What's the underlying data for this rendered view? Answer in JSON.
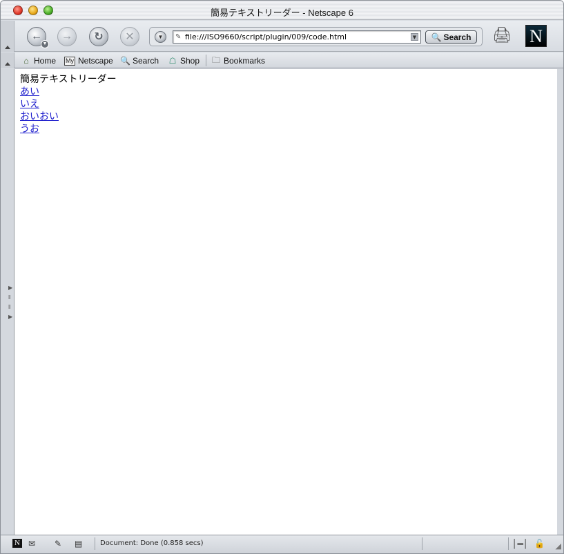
{
  "window": {
    "title": "簡易テキストリーダー - Netscape 6"
  },
  "navigation": {
    "back_icon": "back-arrow-icon",
    "forward_icon": "forward-arrow-icon",
    "reload_icon": "reload-icon",
    "stop_icon": "stop-icon",
    "url": "file:///ISO9660/script/plugin/009/code.html",
    "search_label": "Search"
  },
  "personal_toolbar": {
    "items": [
      {
        "label": "Home",
        "icon": "home-icon"
      },
      {
        "label": "Netscape",
        "icon": "my-netscape-icon"
      },
      {
        "label": "Search",
        "icon": "search-icon"
      },
      {
        "label": "Shop",
        "icon": "shop-icon"
      },
      {
        "label": "Bookmarks",
        "icon": "folder-icon"
      }
    ]
  },
  "page": {
    "heading": "簡易テキストリーダー",
    "links": [
      "あい",
      "いえ",
      "おいおい",
      "うお"
    ]
  },
  "status": {
    "text": "Document: Done (0.858 secs)"
  },
  "colors": {
    "link": "#1a1acc",
    "chrome": "#d9dde3"
  }
}
